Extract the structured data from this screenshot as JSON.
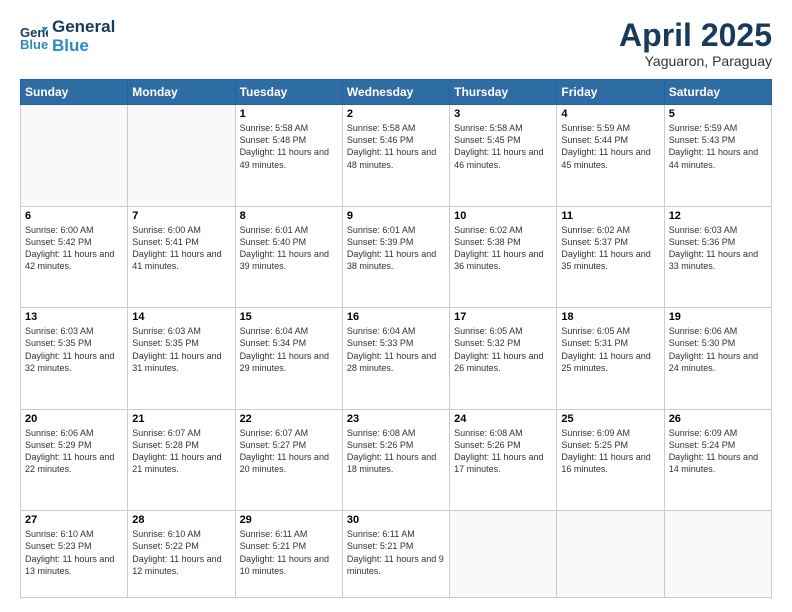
{
  "header": {
    "logo_line1": "General",
    "logo_line2": "Blue",
    "month_year": "April 2025",
    "location": "Yaguaron, Paraguay"
  },
  "weekdays": [
    "Sunday",
    "Monday",
    "Tuesday",
    "Wednesday",
    "Thursday",
    "Friday",
    "Saturday"
  ],
  "weeks": [
    [
      {
        "day": "",
        "info": ""
      },
      {
        "day": "",
        "info": ""
      },
      {
        "day": "1",
        "info": "Sunrise: 5:58 AM\nSunset: 5:48 PM\nDaylight: 11 hours and 49 minutes."
      },
      {
        "day": "2",
        "info": "Sunrise: 5:58 AM\nSunset: 5:46 PM\nDaylight: 11 hours and 48 minutes."
      },
      {
        "day": "3",
        "info": "Sunrise: 5:58 AM\nSunset: 5:45 PM\nDaylight: 11 hours and 46 minutes."
      },
      {
        "day": "4",
        "info": "Sunrise: 5:59 AM\nSunset: 5:44 PM\nDaylight: 11 hours and 45 minutes."
      },
      {
        "day": "5",
        "info": "Sunrise: 5:59 AM\nSunset: 5:43 PM\nDaylight: 11 hours and 44 minutes."
      }
    ],
    [
      {
        "day": "6",
        "info": "Sunrise: 6:00 AM\nSunset: 5:42 PM\nDaylight: 11 hours and 42 minutes."
      },
      {
        "day": "7",
        "info": "Sunrise: 6:00 AM\nSunset: 5:41 PM\nDaylight: 11 hours and 41 minutes."
      },
      {
        "day": "8",
        "info": "Sunrise: 6:01 AM\nSunset: 5:40 PM\nDaylight: 11 hours and 39 minutes."
      },
      {
        "day": "9",
        "info": "Sunrise: 6:01 AM\nSunset: 5:39 PM\nDaylight: 11 hours and 38 minutes."
      },
      {
        "day": "10",
        "info": "Sunrise: 6:02 AM\nSunset: 5:38 PM\nDaylight: 11 hours and 36 minutes."
      },
      {
        "day": "11",
        "info": "Sunrise: 6:02 AM\nSunset: 5:37 PM\nDaylight: 11 hours and 35 minutes."
      },
      {
        "day": "12",
        "info": "Sunrise: 6:03 AM\nSunset: 5:36 PM\nDaylight: 11 hours and 33 minutes."
      }
    ],
    [
      {
        "day": "13",
        "info": "Sunrise: 6:03 AM\nSunset: 5:35 PM\nDaylight: 11 hours and 32 minutes."
      },
      {
        "day": "14",
        "info": "Sunrise: 6:03 AM\nSunset: 5:35 PM\nDaylight: 11 hours and 31 minutes."
      },
      {
        "day": "15",
        "info": "Sunrise: 6:04 AM\nSunset: 5:34 PM\nDaylight: 11 hours and 29 minutes."
      },
      {
        "day": "16",
        "info": "Sunrise: 6:04 AM\nSunset: 5:33 PM\nDaylight: 11 hours and 28 minutes."
      },
      {
        "day": "17",
        "info": "Sunrise: 6:05 AM\nSunset: 5:32 PM\nDaylight: 11 hours and 26 minutes."
      },
      {
        "day": "18",
        "info": "Sunrise: 6:05 AM\nSunset: 5:31 PM\nDaylight: 11 hours and 25 minutes."
      },
      {
        "day": "19",
        "info": "Sunrise: 6:06 AM\nSunset: 5:30 PM\nDaylight: 11 hours and 24 minutes."
      }
    ],
    [
      {
        "day": "20",
        "info": "Sunrise: 6:06 AM\nSunset: 5:29 PM\nDaylight: 11 hours and 22 minutes."
      },
      {
        "day": "21",
        "info": "Sunrise: 6:07 AM\nSunset: 5:28 PM\nDaylight: 11 hours and 21 minutes."
      },
      {
        "day": "22",
        "info": "Sunrise: 6:07 AM\nSunset: 5:27 PM\nDaylight: 11 hours and 20 minutes."
      },
      {
        "day": "23",
        "info": "Sunrise: 6:08 AM\nSunset: 5:26 PM\nDaylight: 11 hours and 18 minutes."
      },
      {
        "day": "24",
        "info": "Sunrise: 6:08 AM\nSunset: 5:26 PM\nDaylight: 11 hours and 17 minutes."
      },
      {
        "day": "25",
        "info": "Sunrise: 6:09 AM\nSunset: 5:25 PM\nDaylight: 11 hours and 16 minutes."
      },
      {
        "day": "26",
        "info": "Sunrise: 6:09 AM\nSunset: 5:24 PM\nDaylight: 11 hours and 14 minutes."
      }
    ],
    [
      {
        "day": "27",
        "info": "Sunrise: 6:10 AM\nSunset: 5:23 PM\nDaylight: 11 hours and 13 minutes."
      },
      {
        "day": "28",
        "info": "Sunrise: 6:10 AM\nSunset: 5:22 PM\nDaylight: 11 hours and 12 minutes."
      },
      {
        "day": "29",
        "info": "Sunrise: 6:11 AM\nSunset: 5:21 PM\nDaylight: 11 hours and 10 minutes."
      },
      {
        "day": "30",
        "info": "Sunrise: 6:11 AM\nSunset: 5:21 PM\nDaylight: 11 hours and 9 minutes."
      },
      {
        "day": "",
        "info": ""
      },
      {
        "day": "",
        "info": ""
      },
      {
        "day": "",
        "info": ""
      }
    ]
  ]
}
